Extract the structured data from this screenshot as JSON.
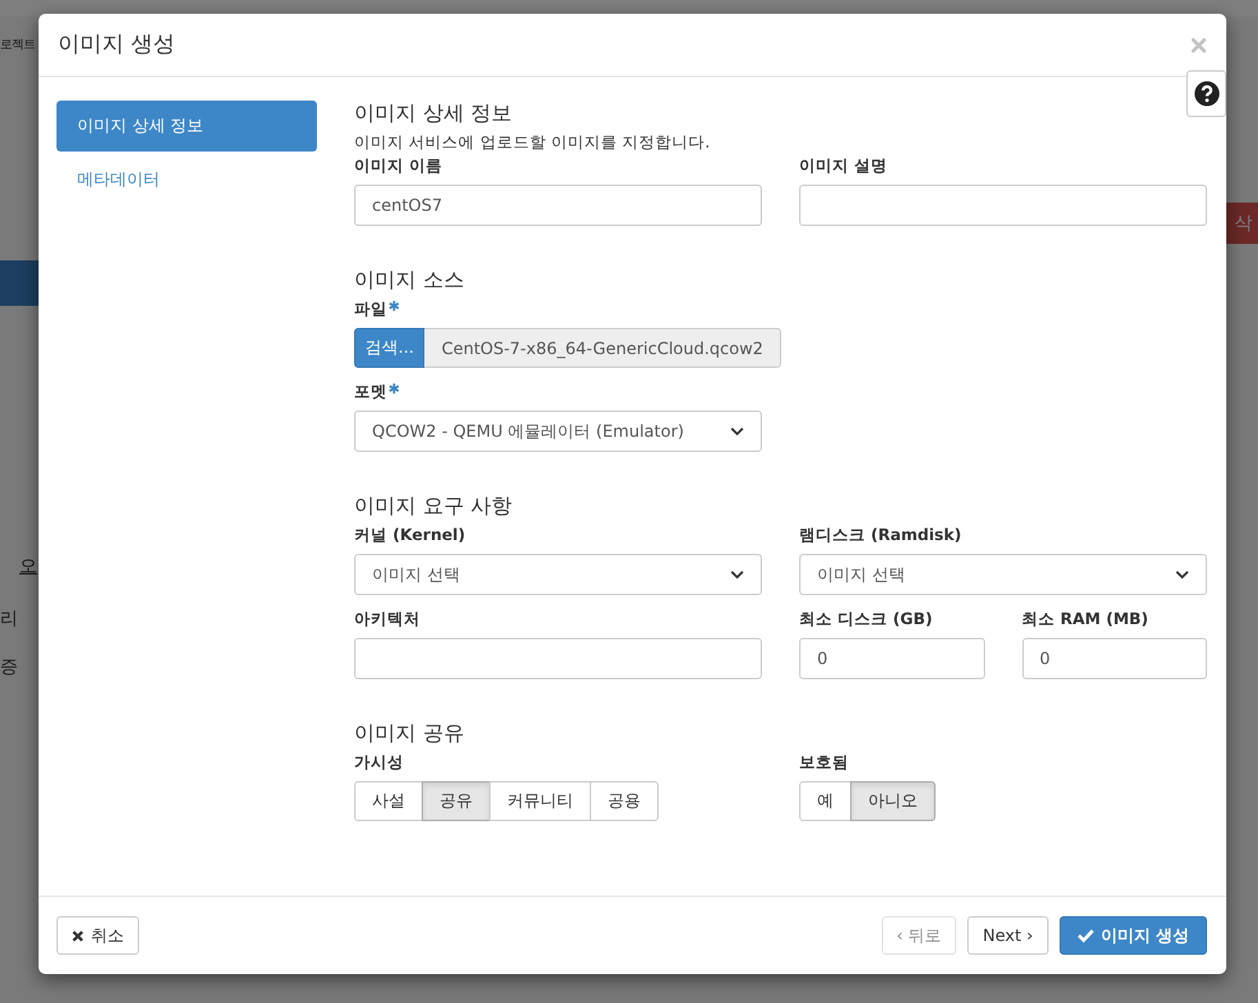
{
  "backdrop": {
    "texts": [
      {
        "kind": "nav",
        "text": "로젝트"
      },
      {
        "kind": "link",
        "text": "오"
      },
      {
        "kind": "nav2",
        "text": "리"
      },
      {
        "kind": "nav3",
        "text": "증"
      },
      {
        "kind": "danger",
        "text": "삭"
      }
    ]
  },
  "modal": {
    "title": "이미지 생성"
  },
  "steps": [
    {
      "label": "이미지 상세 정보",
      "selected": true
    },
    {
      "label": "메타데이터",
      "selected": false
    }
  ],
  "sections": [
    {
      "heading": "이미지 상세 정보",
      "description": "이미지 서비스에 업로드할 이미지를 지정합니다.",
      "rows": [
        [
          {
            "kind": "text",
            "label": "이미지 이름",
            "required": false,
            "value": "centOS7"
          },
          {
            "kind": "text",
            "label": "이미지 설명",
            "required": false
          }
        ]
      ]
    },
    {
      "heading": "이미지 소스",
      "rows": [
        [
          {
            "kind": "file",
            "label": "파일",
            "required": true,
            "button": "검색...",
            "value": "CentOS-7-x86_64-GenericCloud.qcow2"
          }
        ],
        [
          {
            "kind": "select",
            "label": "포멧",
            "required": true,
            "value": "QCOW2 - QEMU 에뮬레이터 (Emulator)"
          }
        ]
      ]
    },
    {
      "heading": "이미지 요구 사항",
      "rows": [
        [
          {
            "kind": "select",
            "label": "커널 (Kernel)",
            "required": false,
            "value": "이미지 선택"
          },
          {
            "kind": "select",
            "label": "램디스크 (Ramdisk)",
            "required": false,
            "value": "이미지 선택"
          }
        ],
        [
          {
            "kind": "text",
            "label": "아키텍처",
            "required": false
          },
          {
            "kind": "number",
            "label": "최소 디스크 (GB)",
            "required": false,
            "value": "0"
          },
          {
            "kind": "number",
            "label": "최소 RAM (MB)",
            "required": false,
            "value": "0"
          }
        ]
      ]
    },
    {
      "heading": "이미지 공유",
      "rows": [
        [
          {
            "kind": "toggle",
            "label": "가시성",
            "required": false,
            "options": [
              {
                "label": "사설",
                "selected": false
              },
              {
                "label": "공유",
                "selected": true
              },
              {
                "label": "커뮤니티",
                "selected": false
              },
              {
                "label": "공용",
                "selected": false
              }
            ]
          },
          {
            "kind": "toggle",
            "label": "보호됨",
            "required": false,
            "options": [
              {
                "label": "예",
                "selected": false
              },
              {
                "label": "아니오",
                "selected": true
              }
            ]
          }
        ]
      ]
    }
  ],
  "footer": {
    "buttons": [
      {
        "kind": "cancel",
        "label": "취소",
        "disabled": false
      },
      {
        "kind": "back",
        "label": "‹ 뒤로",
        "disabled": true
      },
      {
        "kind": "next",
        "label": "Next ›",
        "disabled": false
      },
      {
        "kind": "submit",
        "label": "이미지 생성",
        "disabled": false
      }
    ]
  }
}
